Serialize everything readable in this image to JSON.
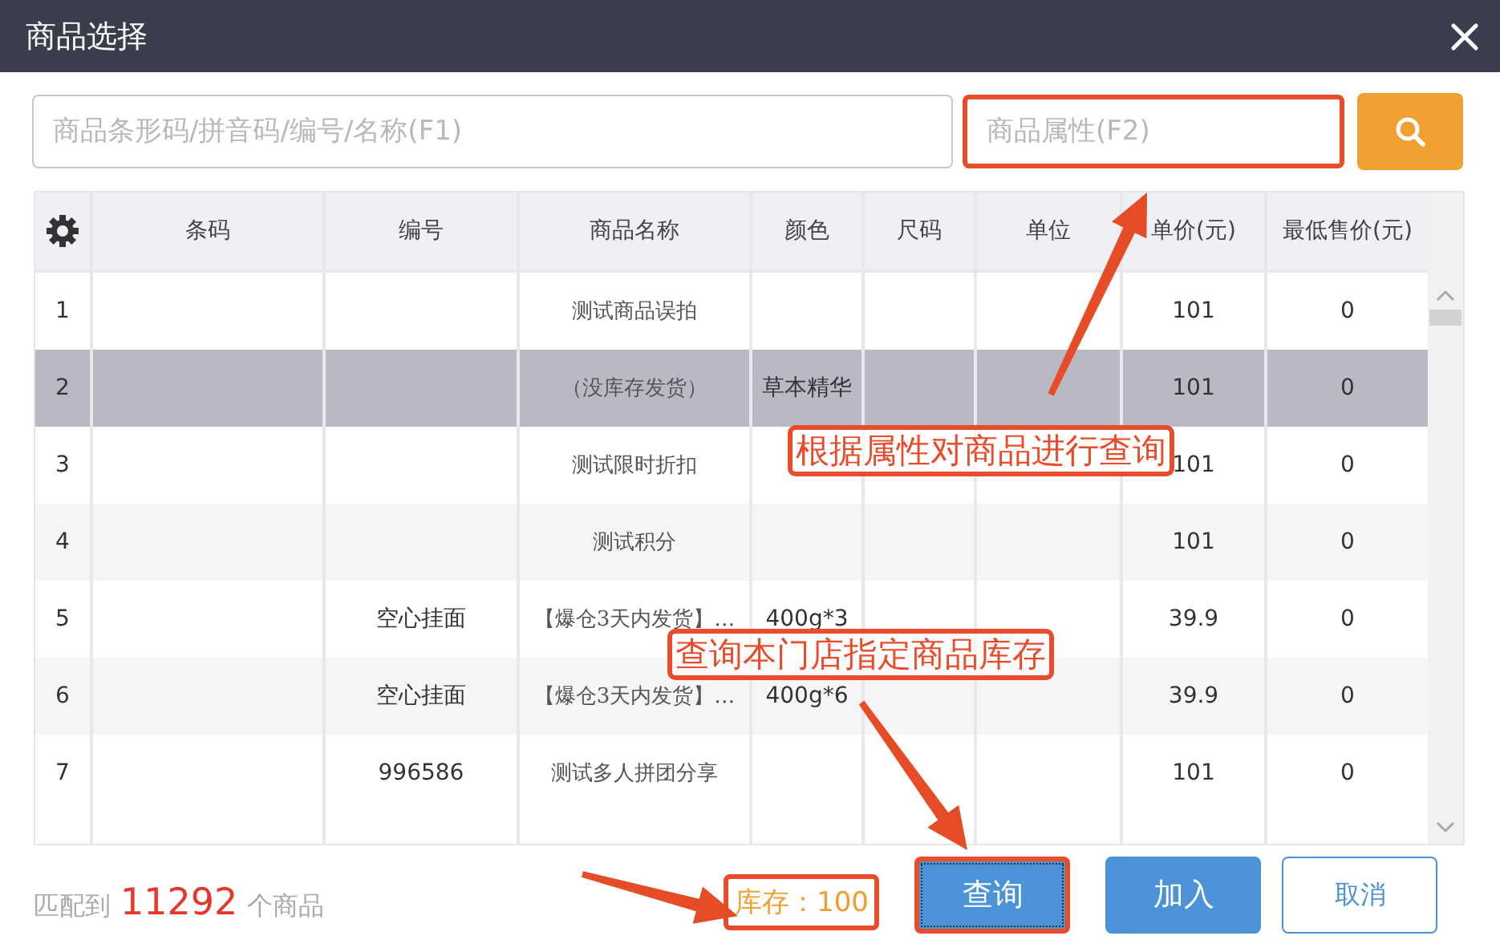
{
  "window": {
    "title": "商品选择"
  },
  "search": {
    "placeholder": "商品条形码/拼音码/编号/名称(F1)"
  },
  "attribute_search": {
    "placeholder": "商品属性(F2)",
    "highlighted": true
  },
  "table": {
    "columns": [
      "条码",
      "编号",
      "商品名称",
      "颜色",
      "尺码",
      "单位",
      "单价(元)",
      "最低售价(元)"
    ],
    "rows": [
      {
        "index": "1",
        "cells": [
          "",
          "",
          "测试商品误拍",
          "",
          "",
          "",
          "101",
          "0"
        ],
        "selected": false
      },
      {
        "index": "2",
        "cells": [
          "",
          "",
          "（没库存发货）",
          "草本精华",
          "",
          "",
          "101",
          "0"
        ],
        "selected": true
      },
      {
        "index": "3",
        "cells": [
          "",
          "",
          "测试限时折扣",
          "",
          "",
          "",
          "101",
          "0"
        ],
        "selected": false
      },
      {
        "index": "4",
        "cells": [
          "",
          "",
          "测试积分",
          "",
          "",
          "",
          "101",
          "0"
        ],
        "selected": false
      },
      {
        "index": "5",
        "cells": [
          "",
          "空心挂面",
          "【爆仓3天内发货】…",
          "400g*3",
          "",
          "",
          "39.9",
          "0"
        ],
        "selected": false
      },
      {
        "index": "6",
        "cells": [
          "",
          "空心挂面",
          "【爆仓3天内发货】…",
          "400g*6",
          "",
          "",
          "39.9",
          "0"
        ],
        "selected": false
      },
      {
        "index": "7",
        "cells": [
          "",
          "996586",
          "测试多人拼团分享",
          "",
          "",
          "",
          "101",
          "0"
        ],
        "selected": false
      }
    ]
  },
  "footer": {
    "prefix": "匹配到",
    "count": "11292",
    "suffix": "个商品",
    "stock": "库存：100",
    "stock_highlighted": true
  },
  "buttons": [
    {
      "label": "查询",
      "kind": "primary",
      "highlighted": true
    },
    {
      "label": "加入",
      "kind": "primary",
      "highlighted": false
    },
    {
      "label": "取消",
      "kind": "secondary",
      "highlighted": false
    }
  ],
  "annotations": [
    {
      "text": "根据属性对商品进行查询"
    },
    {
      "text": "查询本门店指定商品库存"
    }
  ]
}
